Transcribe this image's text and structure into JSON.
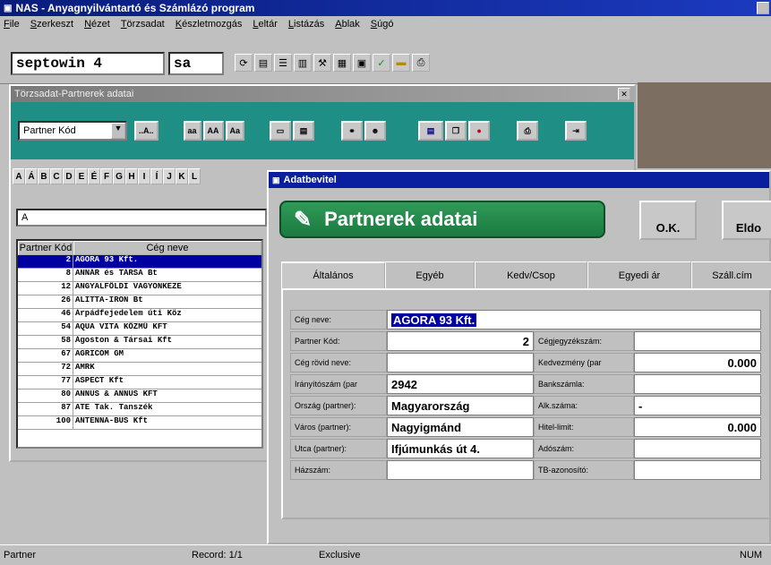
{
  "app": {
    "icon": "app-icon",
    "title": "NAS - Anyagnyilvántartó és Számlázó program"
  },
  "menu": [
    "File",
    "Szerkeszt",
    "Nézet",
    "Törzsadat",
    "Készletmozgás",
    "Leltár",
    "Listázás",
    "Ablak",
    "Súgó"
  ],
  "toolbar": {
    "db_field": "septowin 4",
    "user_field": "sa"
  },
  "partner_window": {
    "title": "Törzsadat-Partnerek adatai",
    "close_label": "✕",
    "sort_combo": "Partner Kód",
    "btn_a": "..A..",
    "btn_aa1": "aa",
    "btn_aa2": "AA",
    "btn_aa3": "Aa",
    "alphabet": [
      "A",
      "Á",
      "B",
      "C",
      "D",
      "E",
      "É",
      "F",
      "G",
      "H",
      "I",
      "Í",
      "J",
      "K",
      "L"
    ],
    "search_value": "A",
    "columns": [
      "Partner Kód",
      "Cég neve"
    ],
    "rows": [
      {
        "code": "2",
        "name": "AGORA 93 Kft."
      },
      {
        "code": "8",
        "name": "ANNÁR és TÁRSA Bt"
      },
      {
        "code": "12",
        "name": "ANGYALFÖLDI VAGYONKEZE"
      },
      {
        "code": "26",
        "name": "ALITTA-IRON Bt"
      },
      {
        "code": "46",
        "name": "Árpádfejedelem úti Köz"
      },
      {
        "code": "54",
        "name": "AQUA VITA KÖZMŰ KFT"
      },
      {
        "code": "58",
        "name": "Ágoston & Társai Kft"
      },
      {
        "code": "67",
        "name": "AGRICOM GM"
      },
      {
        "code": "72",
        "name": "AMRK"
      },
      {
        "code": "77",
        "name": "ASPECT Kft"
      },
      {
        "code": "80",
        "name": "ANNUS & ANNUS KFT"
      },
      {
        "code": "87",
        "name": "ATE Tak. Tanszék"
      },
      {
        "code": "100",
        "name": "ANTENNA-BUS Kft"
      }
    ]
  },
  "dialog": {
    "title": "Adatbevitel",
    "banner": "Partnerek adatai",
    "ok_label": "O.K.",
    "cancel_label": "Eldo",
    "tabs": [
      "Általános",
      "Egyéb",
      "Kedv/Csop",
      "Egyedi ár",
      "Száll.cím"
    ],
    "fields": {
      "ceg_neve_label": "Cég neve:",
      "ceg_neve": "AGORA 93 Kft.",
      "partner_kod_label": "Partner Kód:",
      "partner_kod": "2",
      "cegjegyzekszam_label": "Cégjegyzékszám:",
      "cegjegyzekszam": "",
      "rovid_nev_label": "Cég rövid neve:",
      "rovid_nev": "",
      "kedvezmeny_label": "Kedvezmény (par",
      "kedvezmeny": "0.000",
      "iranyitoszam_label": "Irányítószám (par",
      "iranyitoszam": "2942",
      "bankszamla_label": "Bankszámla:",
      "bankszamla": "",
      "orszag_label": "Ország (partner):",
      "orszag": "Magyarország",
      "alkszama_label": "Alk.száma:",
      "alkszama": "-",
      "varos_label": "Város (partner):",
      "varos": "Nagyigmánd",
      "hitellimit_label": "Hitel-limit:",
      "hitellimit": "0.000",
      "utca_label": "Utca (partner):",
      "utca": "Ifjúmunkás út 4.",
      "adoszam_label": "Adószám:",
      "adoszam": "",
      "hazszam_label": "Házszám:",
      "hazszam": "",
      "tb_label": "TB-azonosító:",
      "tb": ""
    }
  },
  "status": {
    "s1": "Partner",
    "s2": "Record: 1/1",
    "s3": "Exclusive",
    "s4": "NUM"
  },
  "colors": {
    "titlebar": "#1c3ac0",
    "window_toolbar": "#1f8f86",
    "banner": "#2f9a58",
    "selection": "#0000a0"
  }
}
